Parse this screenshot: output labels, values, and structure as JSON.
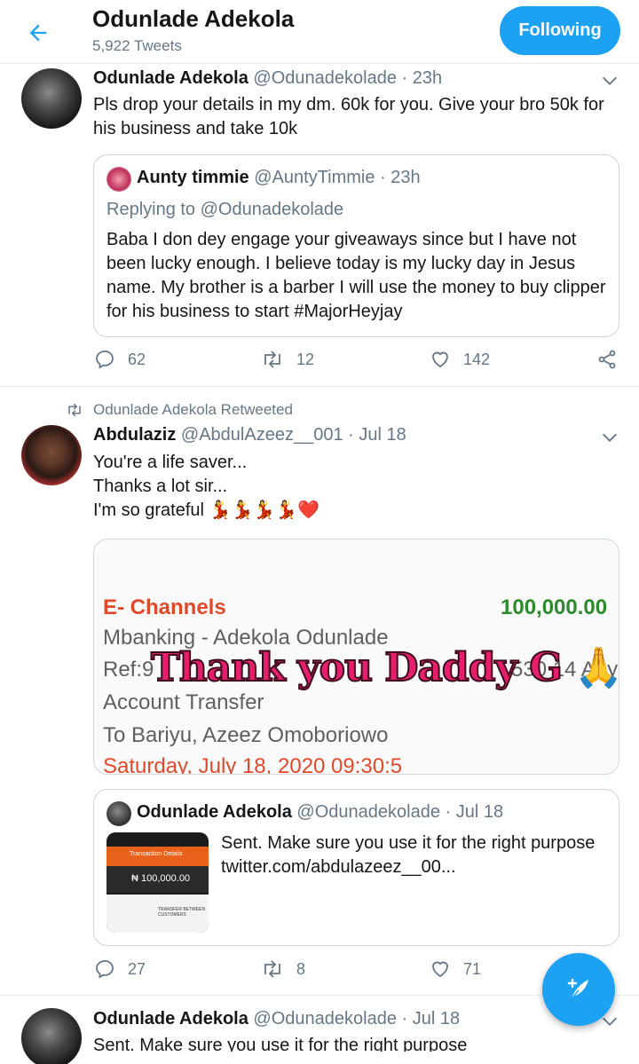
{
  "header": {
    "title": "Odunlade Adekola",
    "tweet_count": "5,922 Tweets",
    "follow_label": "Following"
  },
  "tweet1": {
    "name": "Odunlade Adekola",
    "handle": "@Odunadekolade",
    "time": "· 23h",
    "text": "Pls drop your details in my dm. 60k for you. Give your bro 50k for his business and take 10k",
    "quote": {
      "name": "Aunty timmie",
      "handle": "@AuntyTimmie",
      "time": "· 23h",
      "replying": "Replying to @Odunadekolade",
      "text": "Baba I don dey engage your giveaways since but I have not been lucky enough. I believe today is my lucky day in Jesus name. My brother is a barber I will use the money to buy clipper for his business to start #MajorHeyjay"
    },
    "replies": "62",
    "retweets": "12",
    "likes": "142"
  },
  "tweet2": {
    "retweeted_by": "Odunlade Adekola Retweeted",
    "name": "Abdulaziz",
    "handle": "@AbdulAzeez__001",
    "time": "· Jul 18",
    "line1": "You're a life saver...",
    "line2": "Thanks a lot sir...",
    "line3": "I'm so grateful 💃💃💃💃❤️",
    "image": {
      "line1_label": "E- Channels",
      "line1_amount": "100,000.00",
      "line2": "Mbanking - Adekola Odunlade",
      "line3": "Ref:9",
      "line3_tail": "530 14 Any",
      "line4": "Account Transfer",
      "line5": "To Bariyu, Azeez Omoboriowo",
      "line6": "Saturday, July 18, 2020 09:30:5",
      "overlay": "Thank you Daddy G 🙏"
    },
    "quote": {
      "name": "Odunlade Adekola",
      "handle": "@Odunadekolade",
      "time": "· Jul 18",
      "text": "Sent. Make sure you use it for the right purpose  twitter.com/abdulazeez__00...",
      "thumb_amount": "₦ 100,000.00",
      "thumb_title": "Transaction Details",
      "thumb_type": "TRANSFER BETWEEN CUSTOMERS"
    },
    "replies": "27",
    "retweets": "8",
    "likes": "71"
  },
  "tweet3": {
    "name": "Odunlade Adekola",
    "handle": "@Odunadekolade",
    "time": "· Jul 18",
    "text": "Sent. Make sure you use it for the right purpose"
  },
  "colors": {
    "accent": "#1da1f2",
    "secondary_text": "#657786",
    "border": "#e6ecf0"
  }
}
